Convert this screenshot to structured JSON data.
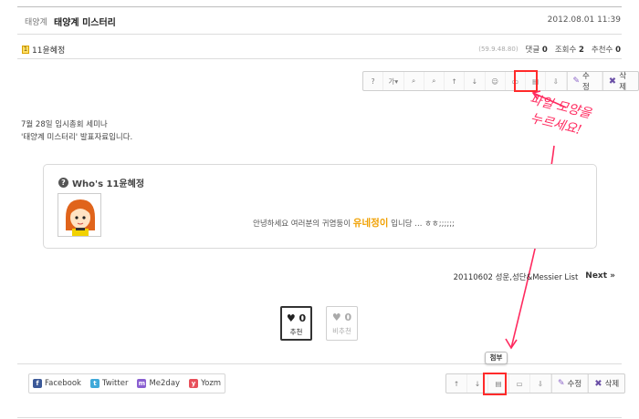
{
  "header": {
    "category": "태양계",
    "title": "태양계 미스터리",
    "date": "2012.08.01 11:39"
  },
  "author": {
    "level": "1",
    "name": "11윤혜정"
  },
  "stats": {
    "ip": "(59.9.48.80)",
    "comments_label": "댓글",
    "comments": "0",
    "views_label": "조회수",
    "views": "2",
    "likes_label": "추천수",
    "likes": "0"
  },
  "toolbar": {
    "icons": [
      "?",
      "가▾",
      "⌕",
      "⌕",
      "↑",
      "↓",
      "☺",
      "▭",
      "▤",
      "⇩"
    ],
    "edit_label": "수정",
    "delete_label": "삭제"
  },
  "body": {
    "line1": "7월 28일 임시총회 세미나",
    "line2": "'태양계 미스터리' 발표자료입니다."
  },
  "signature": {
    "title": "Who's 11윤혜정",
    "message_pre": "안녕하세요 여러분의 귀염둥이",
    "message_highlight": "유네정이",
    "message_post": "입니당 ... ㅎㅎ;;;;;;"
  },
  "next": {
    "title": "20110602 성운,성단&Messier List",
    "label": "Next »"
  },
  "votes": {
    "up_count": "♥ 0",
    "up_label": "추천",
    "down_count": "♥ 0",
    "down_label": "비추천"
  },
  "share": {
    "facebook": "Facebook",
    "twitter": "Twitter",
    "me2day": "Me2day",
    "yozm": "Yozm"
  },
  "bottom_toolbar": {
    "icons": [
      "↑",
      "↓",
      "▤",
      "▭",
      "⇩"
    ],
    "edit_label": "수정",
    "delete_label": "삭제"
  },
  "tooltip": "첨부",
  "annotation": {
    "line1": "파일 모양을",
    "line2": "누르세요!"
  },
  "colors": {
    "highlight": "#ff2a2a",
    "annotation": "#ff2a5f",
    "signature_accent": "#f0a000",
    "facebook": "#3b5998",
    "twitter": "#3fa9d9",
    "me2day": "#8a5fd1",
    "yozm": "#e8505b"
  }
}
